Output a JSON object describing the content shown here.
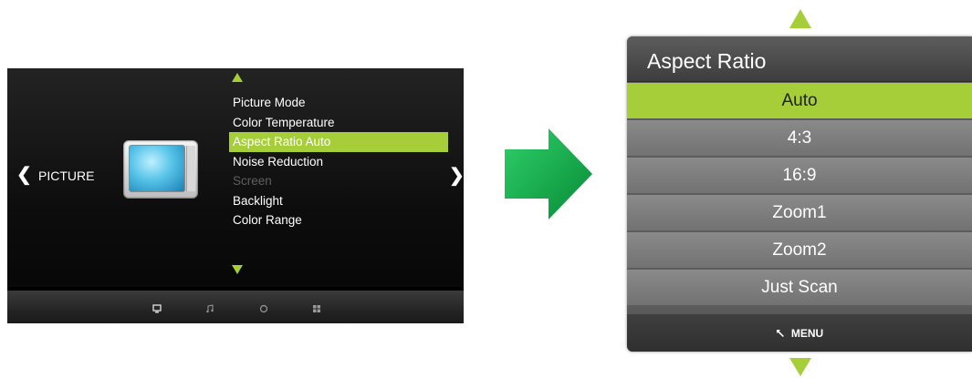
{
  "tv_menu": {
    "category": "PICTURE",
    "nav_left_icon": "chevron-left",
    "nav_right_icon": "chevron-right",
    "items": [
      {
        "label": "Picture Mode",
        "state": "normal"
      },
      {
        "label": "Color Temperature",
        "state": "normal"
      },
      {
        "label": "Aspect Ratio Auto",
        "state": "selected"
      },
      {
        "label": "Noise Reduction",
        "state": "normal"
      },
      {
        "label": "Screen",
        "state": "disabled"
      },
      {
        "label": "Backlight",
        "state": "normal"
      },
      {
        "label": "Color Range",
        "state": "normal"
      }
    ],
    "bottom_icons": [
      "picture-icon",
      "music-icon",
      "circle-icon",
      "grid-icon"
    ]
  },
  "aspect_ratio_menu": {
    "title": "Aspect Ratio",
    "options": [
      {
        "label": "Auto",
        "selected": true
      },
      {
        "label": "4:3",
        "selected": false
      },
      {
        "label": "16:9",
        "selected": false
      },
      {
        "label": "Zoom1",
        "selected": false
      },
      {
        "label": "Zoom2",
        "selected": false
      },
      {
        "label": "Just Scan",
        "selected": false
      }
    ],
    "footer_label": "MENU",
    "footer_icon": "back-arrow-icon"
  },
  "colors": {
    "accent": "#a6ce39",
    "arrow_gradient_start": "#22c45f",
    "arrow_gradient_end": "#0a8f3a"
  }
}
